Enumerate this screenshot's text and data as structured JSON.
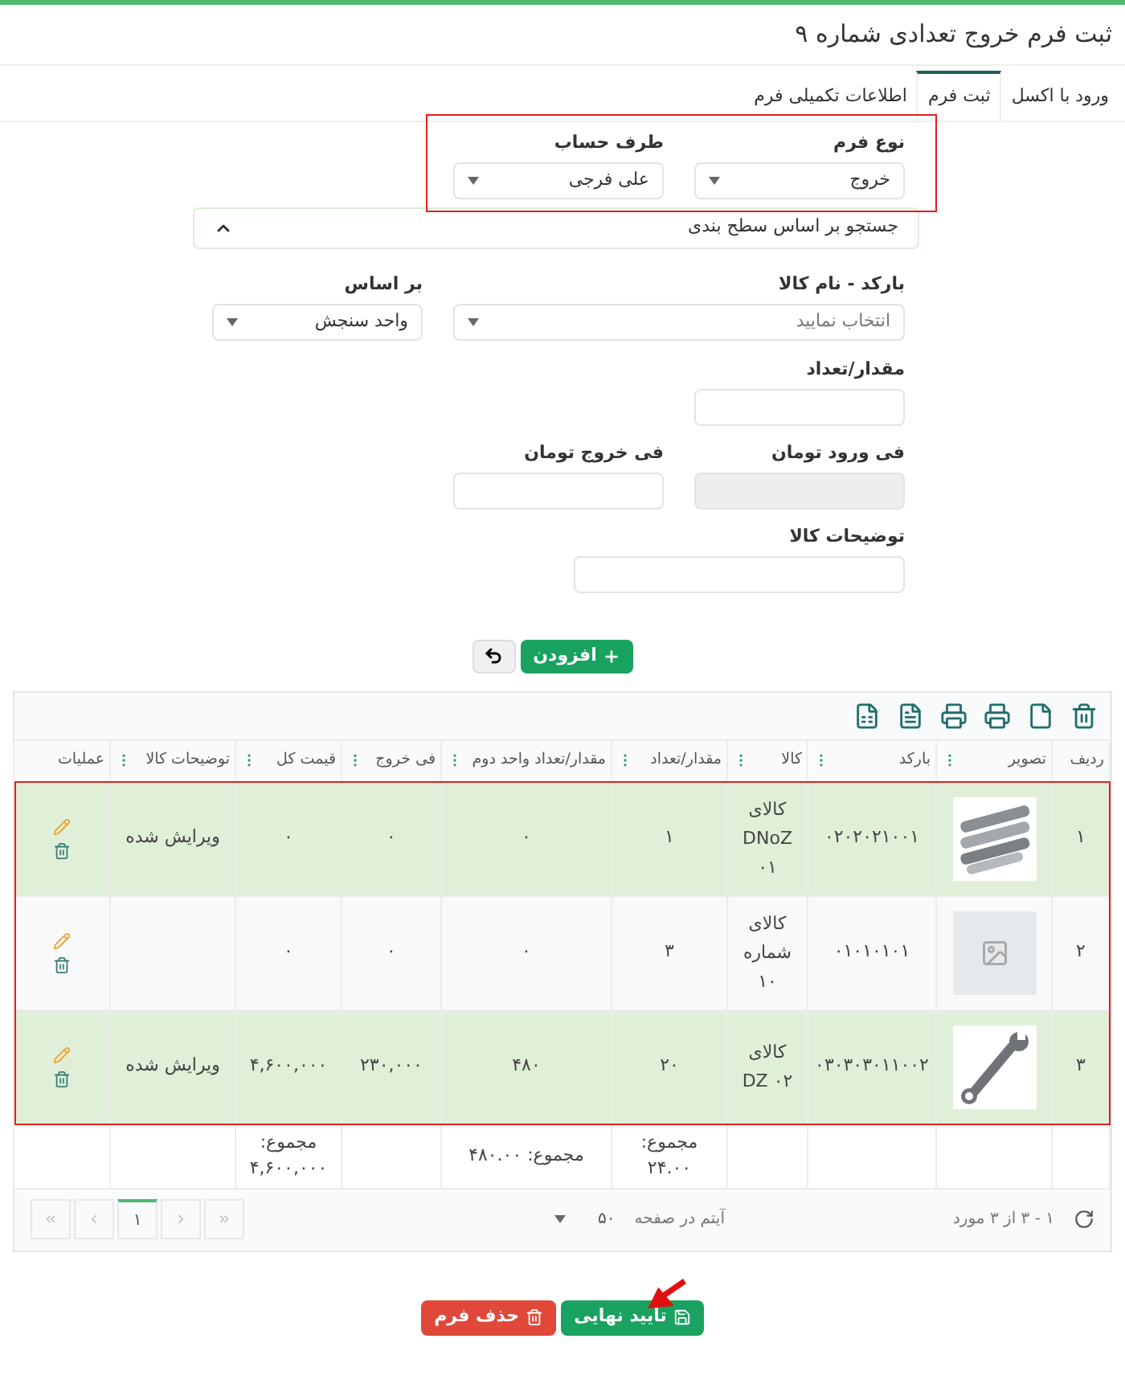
{
  "title": "ثبت فرم خروج تعدادی شماره ۹",
  "tabs": [
    {
      "label": "ورود با اکسل",
      "selected": false
    },
    {
      "label": "ثبت فرم",
      "selected": true
    },
    {
      "label": "اطلاعات تکمیلی فرم",
      "selected": false
    }
  ],
  "form_type": {
    "label": "نوع فرم",
    "value": "خروج"
  },
  "account": {
    "label": "طرف حساب",
    "value": "علی فرجی"
  },
  "search_panel": {
    "label": "جستجو بر اساس سطح بندی"
  },
  "barcode": {
    "label": "بارکد - نام کالا",
    "placeholder": "انتخاب نمایید"
  },
  "basis": {
    "label": "بر اساس",
    "value": "واحد سنجش"
  },
  "quantity": {
    "label": "مقدار/تعداد"
  },
  "price_in": {
    "label": "فی ورود تومان",
    "disabled": true
  },
  "price_out": {
    "label": "فی خروج تومان",
    "disabled": false
  },
  "description": {
    "label": "توضیحات کالا"
  },
  "add_button": "افزودن",
  "table": {
    "columns": [
      {
        "label": "ردیف",
        "menu": false
      },
      {
        "label": "تصویر",
        "menu": true
      },
      {
        "label": "بارکد",
        "menu": true
      },
      {
        "label": "کالا",
        "menu": true
      },
      {
        "label": "مقدار/تعداد",
        "menu": true
      },
      {
        "label": "مقدار/تعداد واحد دوم",
        "menu": true
      },
      {
        "label": "فی خروج",
        "menu": true
      },
      {
        "label": "قیمت کل",
        "menu": true
      },
      {
        "label": "توضیحات کالا",
        "menu": true
      },
      {
        "label": "عملیات",
        "menu": false
      }
    ],
    "rows": [
      {
        "index": "۱",
        "barcode": "۰۲۰۲۰۲۱۰۰۱",
        "name": "کالای DNoZ ۰۱",
        "quantity": "۱",
        "quantity2": "۰",
        "price": "۰",
        "total": "۰",
        "description": "ویرایش شده",
        "highlighted": true
      },
      {
        "index": "۲",
        "kind": "no-image",
        "barcode": "۰۱۰۱۰۱۰۱",
        "name": "کالای شماره ۱۰",
        "quantity": "۳",
        "quantity2": "۰",
        "price": "۰",
        "total": "۰",
        "description": "",
        "highlighted": false
      },
      {
        "index": "۳",
        "barcode": "۰۳۰۳۰۳۰۱۱۰۰۲",
        "name": "کالای DZ ۰۲",
        "quantity": "۲۰",
        "quantity2": "۴۸۰",
        "price": "۲۳۰,۰۰۰",
        "total": "۴,۶۰۰,۰۰۰",
        "description": "ویرایش شده",
        "highlighted": true
      }
    ],
    "footer": {
      "quantity": "مجموع: ۲۴.۰۰",
      "quantity2": "مجموع: ۴۸۰.۰۰",
      "total": "مجموع: ۴,۶۰۰,۰۰۰"
    }
  },
  "pager": {
    "range": "۱ - ۳ از ۳ مورد",
    "page_size": "۵۰",
    "page_size_label": "آیتم در صفحه",
    "page": "۱"
  },
  "confirm_button": "تایید نهایی",
  "delete_button": "حذف فرم"
}
